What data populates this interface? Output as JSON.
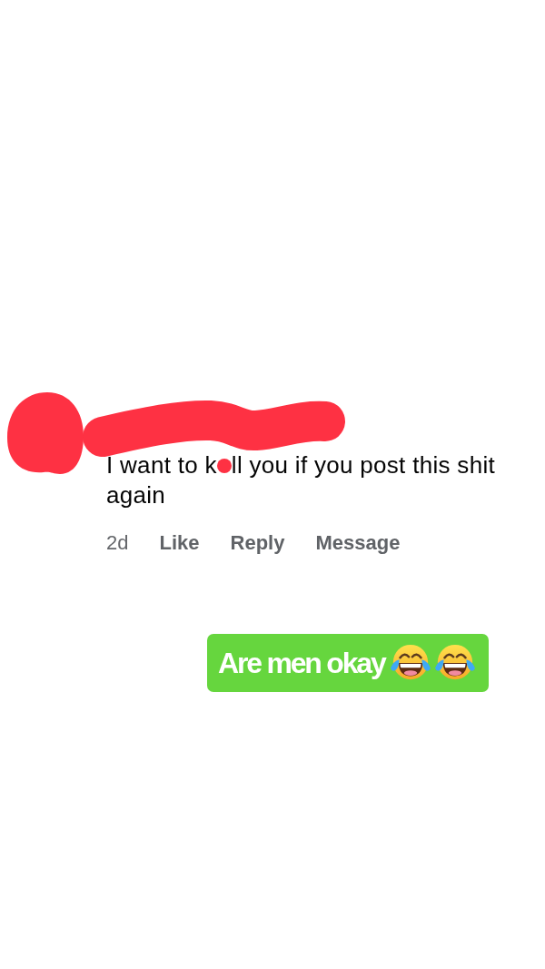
{
  "comment": {
    "text_lines": [
      [
        "I want to k",
        "ll you if you post this shit"
      ],
      [
        "again"
      ]
    ],
    "time": "2d",
    "actions": [
      "Like",
      "Reply",
      "Message"
    ]
  },
  "sticker": {
    "text": "Are men okay"
  }
}
